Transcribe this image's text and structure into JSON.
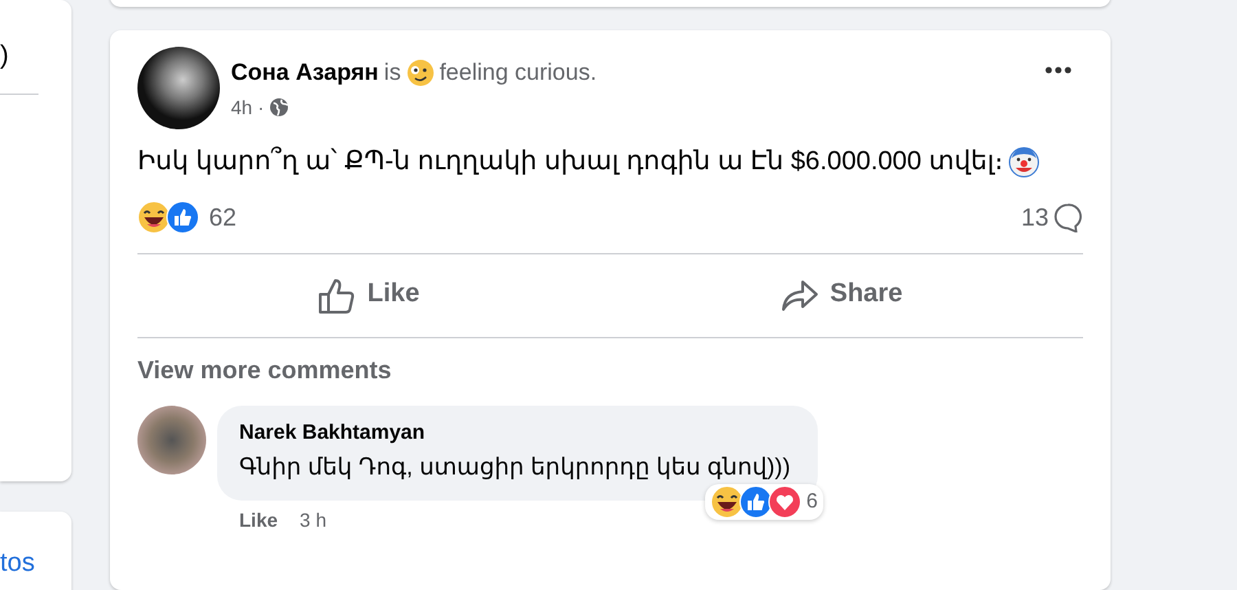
{
  "left_panel": {
    "text": ")",
    "link": "tos"
  },
  "post": {
    "author": "Сона Азарян",
    "feeling_verb": "is",
    "feeling": "feeling curious.",
    "time": "4h ·",
    "text": "Իսկ կարո՞ղ ա՝ ՔՊ-ն ուղղակի սխալ դոգին ա Էն $6.000.000 տվել։",
    "reaction_count": "62",
    "comment_count": "13",
    "actions": [
      {
        "label": "Like",
        "kind": "like"
      },
      {
        "label": "Share",
        "kind": "share"
      }
    ],
    "view_more": "View more comments",
    "comments": [
      {
        "author": "Narek Bakhtamyan",
        "text": "Գնիր մեկ Դոգ, ստացիր երկրորդը կես գնով)))",
        "like": "Like",
        "time": "3 h",
        "reaction_count": "6"
      }
    ]
  }
}
